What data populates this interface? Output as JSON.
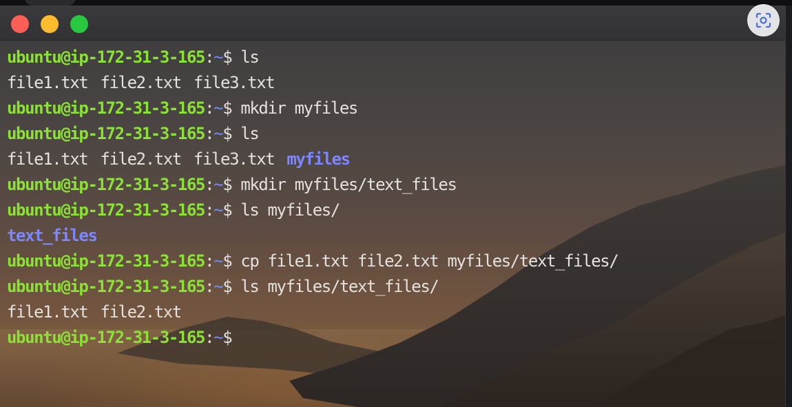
{
  "window": {
    "buttons": {
      "close": "close-button",
      "minimize": "minimize-button",
      "maximize": "maximize-button"
    },
    "corner_icon": "screenshot-capture-icon"
  },
  "prompt": {
    "user_host": "ubuntu@ip-172-31-3-165",
    "colon": ":",
    "path": "~",
    "symbol": "$"
  },
  "lines": [
    {
      "type": "cmd",
      "command": " ls"
    },
    {
      "type": "out",
      "items": [
        {
          "text": "file1.txt",
          "kind": "file"
        },
        {
          "text": "file2.txt",
          "kind": "file"
        },
        {
          "text": "file3.txt",
          "kind": "file"
        }
      ]
    },
    {
      "type": "cmd",
      "command": " mkdir myfiles"
    },
    {
      "type": "cmd",
      "command": " ls"
    },
    {
      "type": "out",
      "items": [
        {
          "text": "file1.txt",
          "kind": "file"
        },
        {
          "text": "file2.txt",
          "kind": "file"
        },
        {
          "text": "file3.txt",
          "kind": "file"
        },
        {
          "text": "myfiles",
          "kind": "dir"
        }
      ]
    },
    {
      "type": "cmd",
      "command": " mkdir myfiles/text_files"
    },
    {
      "type": "cmd",
      "command": " ls myfiles/"
    },
    {
      "type": "out",
      "items": [
        {
          "text": "text_files",
          "kind": "dir"
        }
      ]
    },
    {
      "type": "cmd",
      "command": " cp file1.txt file2.txt myfiles/text_files/"
    },
    {
      "type": "cmd",
      "command": " ls myfiles/text_files/"
    },
    {
      "type": "out",
      "items": [
        {
          "text": "file1.txt",
          "kind": "file"
        },
        {
          "text": "file2.txt",
          "kind": "file"
        }
      ]
    },
    {
      "type": "cmd",
      "command": ""
    }
  ],
  "colors": {
    "prompt_user": "#8ae234",
    "prompt_path": "#6f8cff",
    "directory": "#7b86ff",
    "text": "#e4e1de"
  }
}
